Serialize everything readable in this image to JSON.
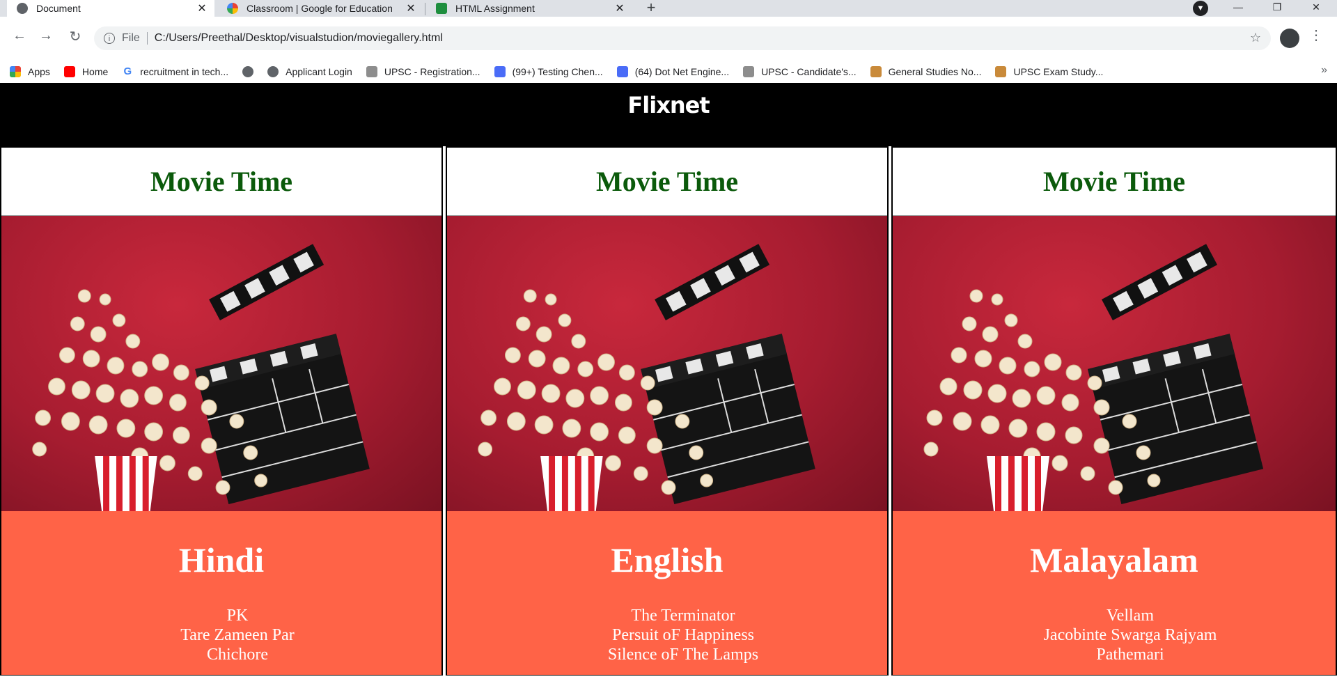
{
  "browser": {
    "tabs": [
      {
        "title": "Document",
        "active": true,
        "icon": "globe-icon"
      },
      {
        "title": "Classroom | Google for Education",
        "active": false,
        "icon": "google-icon"
      },
      {
        "title": "HTML Assignment",
        "active": false,
        "icon": "classroom-icon"
      }
    ],
    "address": {
      "scheme": "File",
      "url": "C:/Users/Preethal/Desktop/visualstudion/moviegallery.html"
    },
    "bookmarks": [
      {
        "label": "Apps",
        "icon": "apps-grid-icon"
      },
      {
        "label": "Home",
        "icon": "youtube-icon"
      },
      {
        "label": "recruitment in tech...",
        "icon": "google-icon"
      },
      {
        "label": "",
        "icon": "globe-icon"
      },
      {
        "label": "Applicant Login",
        "icon": "globe-icon"
      },
      {
        "label": "UPSC - Registration...",
        "icon": "emblem-icon"
      },
      {
        "label": "(99+) Testing Chen...",
        "icon": "chat-icon"
      },
      {
        "label": "(64) Dot Net Engine...",
        "icon": "chat-icon"
      },
      {
        "label": "UPSC - Candidate's...",
        "icon": "emblem-icon"
      },
      {
        "label": "General Studies No...",
        "icon": "figure-icon"
      },
      {
        "label": "UPSC Exam Study...",
        "icon": "figure-icon"
      }
    ],
    "colors": {
      "chrome": "#dee1e6",
      "omnibox": "#f1f3f4"
    }
  },
  "site": {
    "brand": "Flixnet"
  },
  "cards": [
    {
      "heading": "Movie Time",
      "language": "Hindi",
      "movies": [
        "PK",
        "Tare Zameen Par",
        "Chichore"
      ]
    },
    {
      "heading": "Movie Time",
      "language": "English",
      "movies": [
        "The Terminator",
        "Persuit oF Happiness",
        "Silence oF The Lamps"
      ]
    },
    {
      "heading": "Movie Time",
      "language": "Malayalam",
      "movies": [
        "Vellam",
        "Jacobinte Swarga Rajyam",
        "Pathemari"
      ]
    }
  ],
  "colors": {
    "header_bg": "#000000",
    "title_green": "#0b5a0b",
    "tomato": "#ff6347",
    "poster_red": "#a61c30"
  }
}
